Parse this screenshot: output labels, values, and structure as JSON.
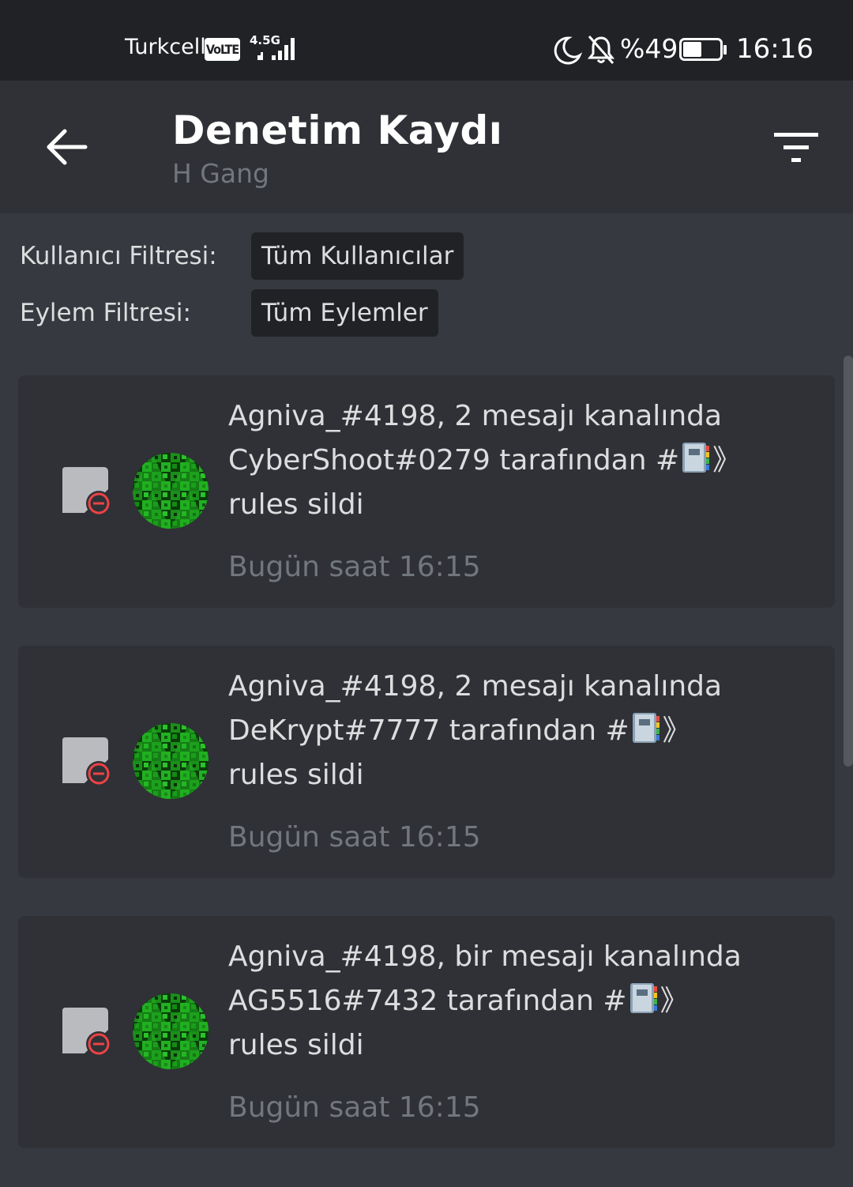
{
  "status_bar": {
    "carrier": "Turkcell",
    "volte": "VoLTE",
    "network": "4.5G",
    "battery": "%49",
    "time": "16:16"
  },
  "header": {
    "title": "Denetim Kaydı",
    "subtitle": "H Gang"
  },
  "filters": {
    "user_label": "Kullanıcı Filtresi:",
    "user_value": "Tüm Kullanıcılar",
    "action_label": "Eylem Filtresi:",
    "action_value": "Tüm Eylemler"
  },
  "entries": [
    {
      "text_before": "Agniva_#4198, 2 mesajı kanalında CyberShoot#0279 tarafından #",
      "text_after": "》 rules sildi",
      "time": "Bugün saat 16:15"
    },
    {
      "text_before": "Agniva_#4198, 2 mesajı kanalında DeKrypt#7777 tarafından #",
      "text_after": "》 rules sildi",
      "time": "Bugün saat 16:15"
    },
    {
      "text_before": "Agniva_#4198, bir mesajı kanalında AG5516#7432 tarafından #",
      "text_after": "》 rules sildi",
      "time": "Bugün saat 16:15"
    }
  ],
  "icons": {
    "back": "arrow-left-icon",
    "filter": "filter-icon",
    "message_delete": "message-delete-icon",
    "emoji": "notebook-emoji-icon"
  },
  "colors": {
    "background": "#36393f",
    "header": "#2f3136",
    "status_bar": "#202225",
    "muted_text": "#72767d",
    "delete_red": "#ed4245"
  }
}
